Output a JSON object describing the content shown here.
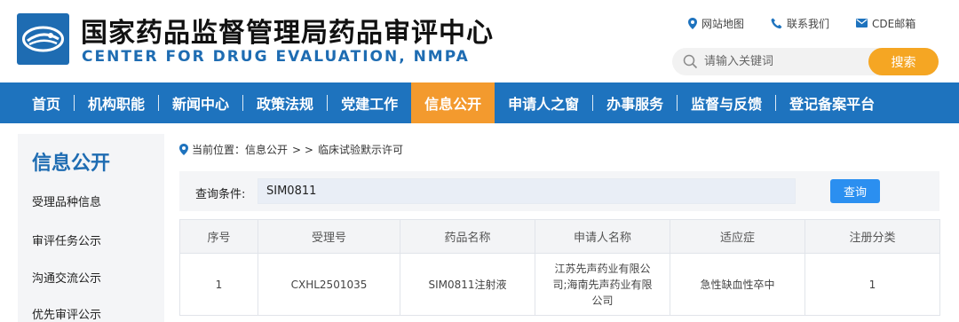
{
  "header": {
    "title_cn": "国家药品监督管理局药品审评中心",
    "title_en": "CENTER FOR DRUG EVALUATION, NMPA",
    "logo_icon": "cde-logo-icon",
    "links": [
      {
        "label": "网站地图",
        "icon": "location-pin-icon"
      },
      {
        "label": "联系我们",
        "icon": "phone-icon"
      },
      {
        "label": "CDE邮箱",
        "icon": "mail-icon"
      }
    ],
    "search": {
      "placeholder": "请输入关键词",
      "button": "搜索"
    }
  },
  "nav": {
    "items": [
      "首页",
      "机构职能",
      "新闻中心",
      "政策法规",
      "党建工作",
      "信息公开",
      "申请人之窗",
      "办事服务",
      "监督与反馈",
      "登记备案平台"
    ],
    "active_index": 5
  },
  "sidebar": {
    "title": "信息公开",
    "items": [
      "受理品种信息",
      "审评任务公示",
      "沟通交流公示",
      "优先审评公示"
    ]
  },
  "breadcrumb": {
    "label": "当前位置：",
    "path": [
      "信息公开",
      "临床试验默示许可"
    ],
    "separator": "> >"
  },
  "query": {
    "label": "查询条件:",
    "value": "SIM0811",
    "button": "查询"
  },
  "table": {
    "columns": [
      "序号",
      "受理号",
      "药品名称",
      "申请人名称",
      "适应症",
      "注册分类"
    ],
    "rows": [
      [
        "1",
        "CXHL2501035",
        "SIM0811注射液",
        "江苏先声药业有限公司;海南先声药业有限公司",
        "急性缺血性卒中",
        "1"
      ]
    ]
  },
  "colors": {
    "brand_blue": "#1e73be",
    "nav_active": "#f39a2e",
    "search_button": "#f5a623",
    "query_button": "#2b8ff0"
  }
}
